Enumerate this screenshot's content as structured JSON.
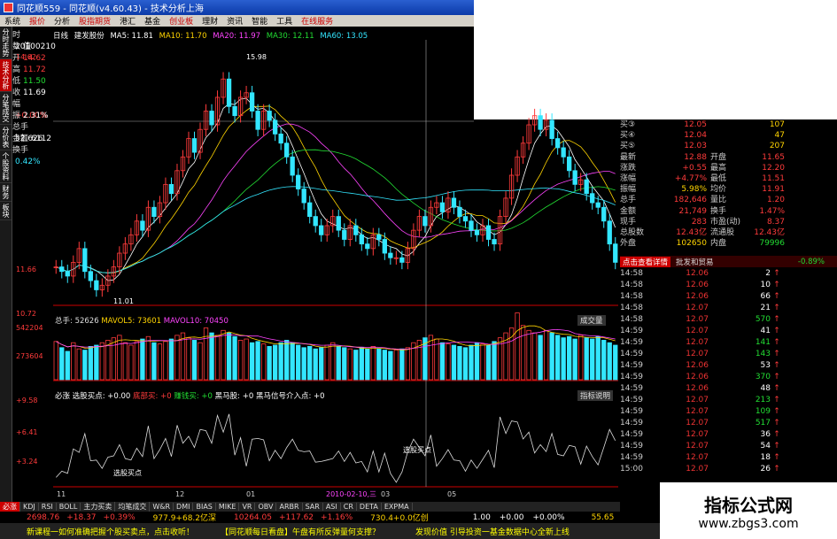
{
  "window": {
    "title": "同花顺559 - 同花顺(v4.60.43) - 技术分析上海"
  },
  "menu": [
    "系统",
    "报价",
    "分析",
    "股指期货",
    "港汇",
    "基金",
    "创业板",
    "理财",
    "资讯",
    "智能",
    "工具",
    "在线服务"
  ],
  "leftstrip": [
    "分时走势",
    "技术分析",
    "分笔成交",
    "分价表",
    "个股资料",
    "财务",
    "板块"
  ],
  "info_panel": [
    {
      "label": "时",
      "value": "20100210"
    },
    {
      "label": "数",
      "value": "值"
    },
    {
      "label": "开",
      "value": "14.62"
    },
    {
      "label": "高",
      "value": "11.72"
    },
    {
      "label": "低",
      "value": "11.50"
    },
    {
      "label": "收",
      "value": "11.69"
    },
    {
      "label": "幅",
      "value": "+0.00%"
    },
    {
      "label": "振",
      "value": "2.31%"
    },
    {
      "label": "总手",
      "value": "52,626"
    },
    {
      "label": "金额",
      "value": "6112"
    },
    {
      "label": "换手",
      "value": "0.42%"
    }
  ],
  "chart_header": {
    "period": "日线",
    "name": "建发股份",
    "ma5": "MA5: 11.81",
    "ma10": "MA10: 11.70",
    "ma20": "MA20: 11.97",
    "ma30": "MA30: 12.11",
    "ma60": "MA60: 13.05"
  },
  "price_axis": [
    "14.62",
    "11.66",
    "10.72"
  ],
  "peak_label": "15.98",
  "trough_label": "11.01",
  "volume_header": {
    "label": "总手: 52626",
    "mavol5": "MAVOL5: 73601",
    "mavol10": "MAVOL10: 70450",
    "btn": "成交量"
  },
  "volume_axis": [
    "542204",
    "273604"
  ],
  "indicator_header": {
    "name": "必涨",
    "a": "选股买点: +0.00",
    "b": "底部买: +0",
    "c": "赚钱买: +0",
    "d": "黑马股: +0",
    "e": "黑马信号介入点: +0",
    "btn": "指标说明"
  },
  "indicator_axis": [
    "+9.58",
    "+6.41",
    "+3.24"
  ],
  "ind_labels": [
    "选股买点",
    "选股买点"
  ],
  "date_axis": [
    "11",
    "12",
    "01",
    "2010-02-10,三",
    "03",
    "05"
  ],
  "chart_data": {
    "type": "candlestick",
    "title": "建发股份",
    "note": "daily candles, approximate, read from chart",
    "closes": [
      11.5,
      11.4,
      11.3,
      11.6,
      11.9,
      11.4,
      11.2,
      11.0,
      11.1,
      11.3,
      11.5,
      11.8,
      12.0,
      12.2,
      12.5,
      12.3,
      12.8,
      12.6,
      12.9,
      13.3,
      13.1,
      13.6,
      13.9,
      14.3,
      14.0,
      14.5,
      14.9,
      14.6,
      15.2,
      15.6,
      15.0,
      14.8,
      15.2,
      15.3,
      14.9,
      14.5,
      14.9,
      14.7,
      14.4,
      14.2,
      13.9,
      13.5,
      13.2,
      12.9,
      12.6,
      12.4,
      12.2,
      12.4,
      12.6,
      12.3,
      12.1,
      12.4,
      12.2,
      12.0,
      11.9,
      12.2,
      12.1,
      11.8,
      11.7,
      11.7,
      11.6,
      11.9,
      12.3,
      12.6,
      12.4,
      12.8,
      12.9,
      12.7,
      13.0,
      12.8,
      12.6,
      12.5,
      12.3,
      12.2,
      12.4,
      12.1,
      12.0,
      12.6,
      13.0,
      13.5,
      13.9,
      14.2,
      14.6,
      14.8,
      14.5,
      14.7,
      14.3,
      14.1,
      13.9,
      13.6,
      13.3,
      13.4,
      13.1,
      12.9,
      12.8,
      12.5,
      12.0,
      11.6
    ],
    "volume": [
      310,
      260,
      230,
      300,
      250,
      240,
      270,
      280,
      300,
      320,
      340,
      360,
      300,
      280,
      310,
      330,
      350,
      300,
      290,
      310,
      330,
      360,
      380,
      340,
      320,
      300,
      420,
      380,
      360,
      400,
      380,
      350,
      320,
      330,
      300,
      310,
      290,
      270,
      280,
      300,
      320,
      300,
      280,
      260,
      270,
      250,
      260,
      280,
      300,
      270,
      260,
      250,
      240,
      260,
      250,
      270,
      250,
      240,
      230,
      240,
      250,
      260,
      300,
      320,
      340,
      360,
      330,
      300,
      290,
      280,
      270,
      260,
      280,
      300,
      290,
      280,
      310,
      340,
      380,
      420,
      542,
      440,
      400,
      380,
      360,
      400,
      380,
      360,
      340,
      350,
      330,
      360,
      340,
      330,
      350,
      320,
      300,
      280
    ]
  },
  "quote": [
    {
      "a": "买③",
      "b": "12.05",
      "c": "",
      "d": "107"
    },
    {
      "a": "买④",
      "b": "12.04",
      "c": "",
      "d": "47"
    },
    {
      "a": "买⑤",
      "b": "12.03",
      "c": "",
      "d": "207"
    },
    {
      "a": "最新",
      "b": "12.88",
      "c": "开盘",
      "d": "11.65"
    },
    {
      "a": "涨跌",
      "b": "+0.55",
      "c": "最高",
      "d": "12.20"
    },
    {
      "a": "涨幅",
      "b": "+4.77%",
      "c": "最低",
      "d": "11.51"
    },
    {
      "a": "振幅",
      "b": "5.98%",
      "c": "均价",
      "d": "11.91"
    },
    {
      "a": "总手",
      "b": "182,646",
      "c": "量比",
      "d": "1.20"
    },
    {
      "a": "金额",
      "b": "21,749",
      "c": "换手",
      "d": "1.47%"
    },
    {
      "a": "现手",
      "b": "283",
      "c": "市盈(动)",
      "d": "8.37"
    },
    {
      "a": "总股数",
      "b": "12.43亿",
      "c": "流通股",
      "d": "12.43亿"
    },
    {
      "a": "外盘",
      "b": "102650",
      "c": "内盘",
      "d": "79996"
    }
  ],
  "detail_header": {
    "btn": "点击查看详情",
    "label": "批发和贸易",
    "pct": "-0.89%"
  },
  "ticks": [
    {
      "t": "14:58",
      "p": "12.06",
      "v": "2",
      "d": "up"
    },
    {
      "t": "14:58",
      "p": "12.06",
      "v": "10",
      "d": "up"
    },
    {
      "t": "14:58",
      "p": "12.06",
      "v": "66",
      "d": "up"
    },
    {
      "t": "14:58",
      "p": "12.07",
      "v": "21",
      "d": "up"
    },
    {
      "t": "14:58",
      "p": "12.07",
      "v": "570",
      "d": "up"
    },
    {
      "t": "14:59",
      "p": "12.07",
      "v": "41",
      "d": "up"
    },
    {
      "t": "14:59",
      "p": "12.07",
      "v": "141",
      "d": "up"
    },
    {
      "t": "14:59",
      "p": "12.07",
      "v": "143",
      "d": "up"
    },
    {
      "t": "14:59",
      "p": "12.06",
      "v": "53",
      "d": "up"
    },
    {
      "t": "14:59",
      "p": "12.06",
      "v": "370",
      "d": "up"
    },
    {
      "t": "14:59",
      "p": "12.06",
      "v": "48",
      "d": "up"
    },
    {
      "t": "14:59",
      "p": "12.07",
      "v": "213",
      "d": "up"
    },
    {
      "t": "14:59",
      "p": "12.07",
      "v": "109",
      "d": "up"
    },
    {
      "t": "14:59",
      "p": "12.07",
      "v": "517",
      "d": "up"
    },
    {
      "t": "14:59",
      "p": "12.07",
      "v": "36",
      "d": "up"
    },
    {
      "t": "14:59",
      "p": "12.07",
      "v": "54",
      "d": "up"
    },
    {
      "t": "14:59",
      "p": "12.07",
      "v": "18",
      "d": "up"
    },
    {
      "t": "15:00",
      "p": "12.07",
      "v": "26",
      "d": "up"
    }
  ],
  "bottom_tabs": [
    "必涨",
    "KDJ",
    "RSI",
    "BOLL",
    "主力买卖",
    "均笔成交",
    "W&R",
    "DMI",
    "BIAS",
    "MIKE",
    "VR",
    "OBV",
    "ARBR",
    "SAR",
    "ASI",
    "CR",
    "DETA",
    "EXPMA"
  ],
  "status1": {
    "a": "2698.76",
    "b": "+18.37",
    "c": "+0.39%",
    "d": "977.9+68.2亿深",
    "e": "10264.05",
    "f": "+117.62",
    "g": "+1.16%",
    "h": "730.4+0.0亿创",
    "i": "1.00",
    "j": "+0.00",
    "k": "+0.00%",
    "l": "55.65"
  },
  "status2": {
    "a": "新课程一如何准确把握个股买卖点，点击收听！",
    "b": "【同花顺每日看盘】午盘有所反弹量何支撑？",
    "c": "发现价值 引导投资一基金数据中心全新上线"
  },
  "watermark": {
    "title": "指标公式网",
    "url": "www.zbgs3.com"
  },
  "colors": {
    "up": "#ff3b3b",
    "down": "#33e6ff",
    "bg": "#000000",
    "accent": "#cc0000"
  }
}
